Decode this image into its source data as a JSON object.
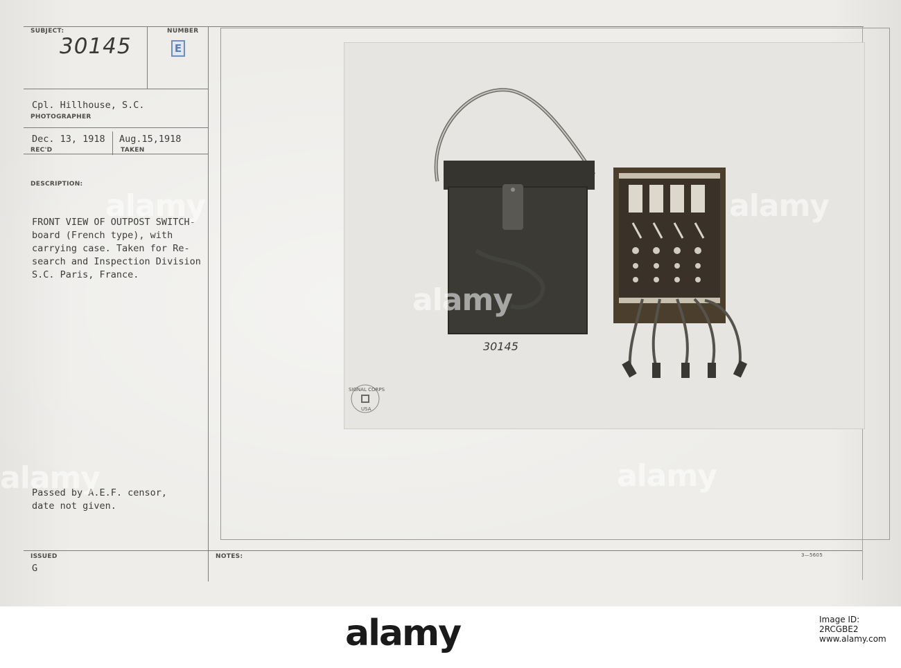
{
  "record": {
    "subject_label": "SUBJECT:",
    "subject_value": "30145",
    "number_label": "NUMBER",
    "number_value": "E",
    "photographer_value": "Cpl. Hillhouse, S.C.",
    "photographer_label": "PHOTOGRAPHER",
    "received_value": "Dec. 13, 1918",
    "received_label": "REC'D",
    "taken_value": "Aug.15,1918",
    "taken_label": "TAKEN",
    "description_label": "DESCRIPTION:",
    "description_lines": [
      "FRONT VIEW OF OUTPOST SWITCH-",
      "board (French type), with",
      "carrying case. Taken for Re-",
      "search and Inspection Division",
      "S.C. Paris, France."
    ],
    "censor_lines": [
      "Passed by A.E.F. censor,",
      "date not given."
    ],
    "issued_label": "ISSUED",
    "issued_value": "G",
    "notes_label": "NOTES:",
    "form_code": "3—5605"
  },
  "photo": {
    "number": "30145",
    "seal_top": "SIGNAL CORPS",
    "seal_bottom": "USA"
  },
  "watermark": {
    "text": "alamy"
  },
  "footer": {
    "logo": "alamy",
    "image_id_line1": "Image ID: 2RCGBE2",
    "image_id_line2": "www.alamy.com"
  }
}
